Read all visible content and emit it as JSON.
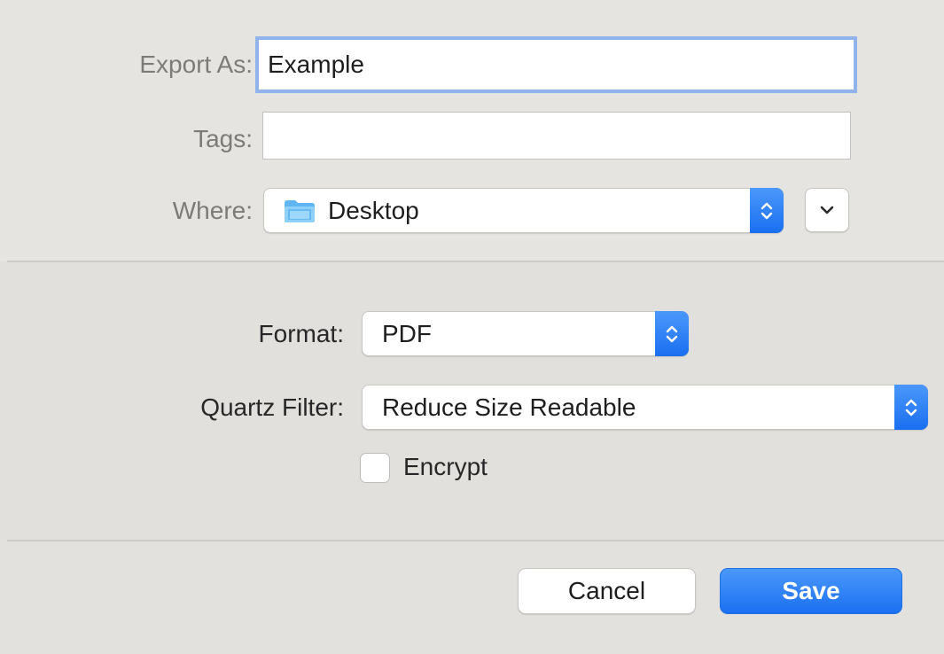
{
  "export_section": {
    "export_as_label": "Export As:",
    "filename_value": "Example",
    "tags_label": "Tags:",
    "tags_value": "",
    "where_label": "Where:",
    "where_value": "Desktop",
    "where_icon": "folder-icon"
  },
  "options_section": {
    "format_label": "Format:",
    "format_value": "PDF",
    "quartz_filter_label": "Quartz Filter:",
    "quartz_filter_value": "Reduce Size Readable",
    "encrypt_label": "Encrypt",
    "encrypt_checked": false
  },
  "buttons": {
    "cancel_label": "Cancel",
    "save_label": "Save"
  },
  "colors": {
    "accent": "#1b70f0",
    "focus_ring": "#8fb3ea",
    "background": "#e3e1dd"
  }
}
